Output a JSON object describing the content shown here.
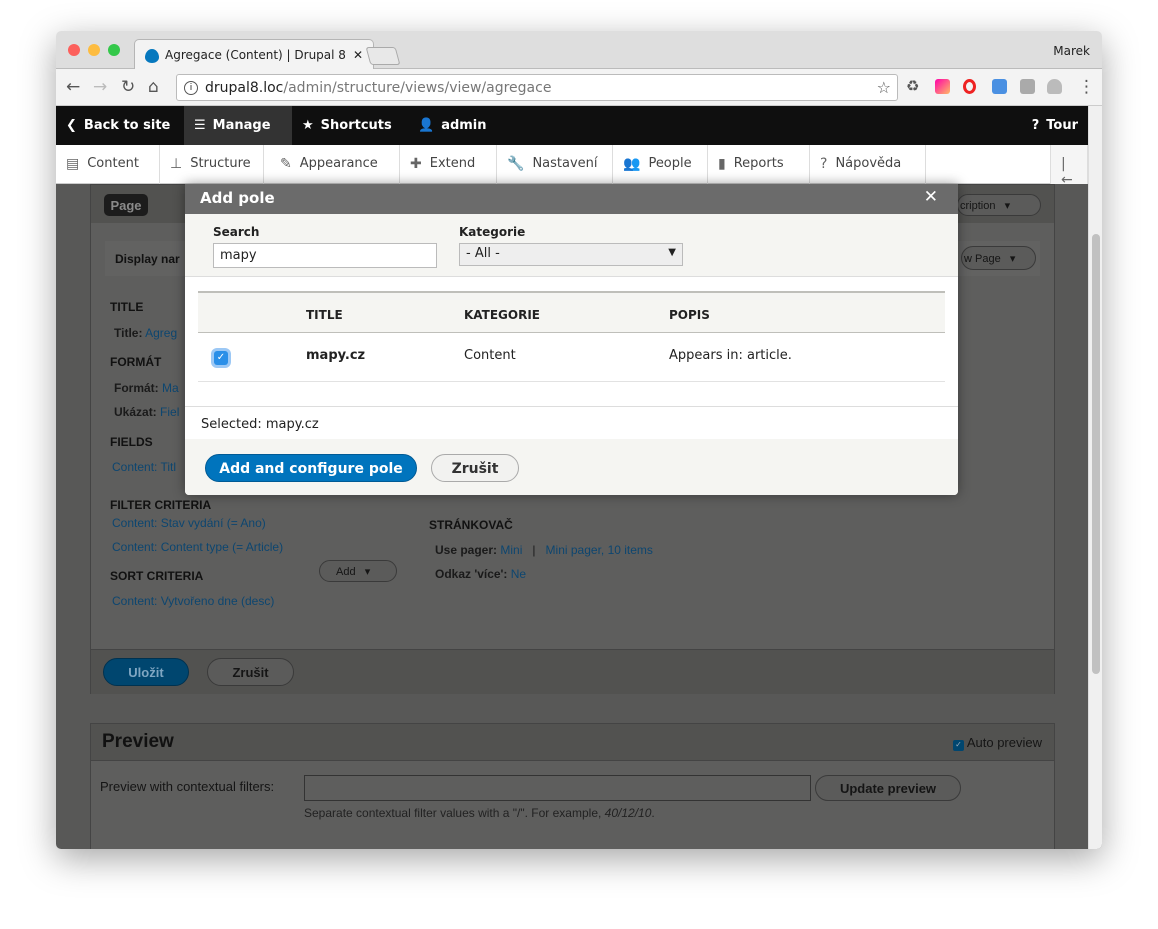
{
  "browser": {
    "tab_title": "Agregace (Content) | Drupal 8",
    "user": "Marek",
    "url_host": "drupal8.loc",
    "url_path": "/admin/structure/views/view/agregace"
  },
  "adminbar": {
    "back": "Back to site",
    "manage": "Manage",
    "shortcuts": "Shortcuts",
    "user": "admin",
    "tour": "Tour"
  },
  "tray": [
    "Content",
    "Structure",
    "Appearance",
    "Extend",
    "Nastavení",
    "People",
    "Reports",
    "Nápověda"
  ],
  "view": {
    "page_tab": "Page",
    "display_name": "Display nar",
    "desc_btn": "cription",
    "page_btn": "w Page",
    "title_h": "TITLE",
    "title_row": "Title:",
    "title_val": "Agreg",
    "format_h": "FORMÁT",
    "format_row": "Formát:",
    "format_val": "Ma",
    "show_row": "Ukázat:",
    "show_val": "Fiel",
    "fields_h": "FIELDS",
    "fields_val": "Content: Titl",
    "filter_h": "FILTER CRITERIA",
    "filter1": "Content: Stav vydání (= Ano)",
    "filter2": "Content: Content type (= Article)",
    "sort_h": "SORT CRITERIA",
    "sort1": "Content: Vytvořeno dne (desc)",
    "add": "Add",
    "pager_h": "STRÁNKOVAČ",
    "pager_lbl": "Use pager:",
    "pager_val1": "Mini",
    "pager_sep": "|",
    "pager_val2": "Mini pager, 10 items",
    "more_lbl": "Odkaz 'více':",
    "more_val": "Ne",
    "save": "Uložit",
    "cancel": "Zrušit"
  },
  "preview": {
    "title": "Preview",
    "auto": "Auto preview",
    "label": "Preview with contextual filters:",
    "button": "Update preview",
    "help": "Separate contextual filter values with a \"/\". For example, ",
    "help_example": "40/12/10",
    "help_end": "."
  },
  "modal": {
    "title": "Add pole",
    "search_label": "Search",
    "search_value": "mapy",
    "category_label": "Kategorie",
    "category_value": "- All -",
    "columns": [
      "TITLE",
      "KATEGORIE",
      "POPIS"
    ],
    "rows": [
      {
        "checked": true,
        "title": "mapy.cz",
        "category": "Content",
        "description": "Appears in: article."
      }
    ],
    "selected": "Selected: mapy.cz",
    "primary": "Add and configure pole",
    "cancel": "Zrušit"
  }
}
